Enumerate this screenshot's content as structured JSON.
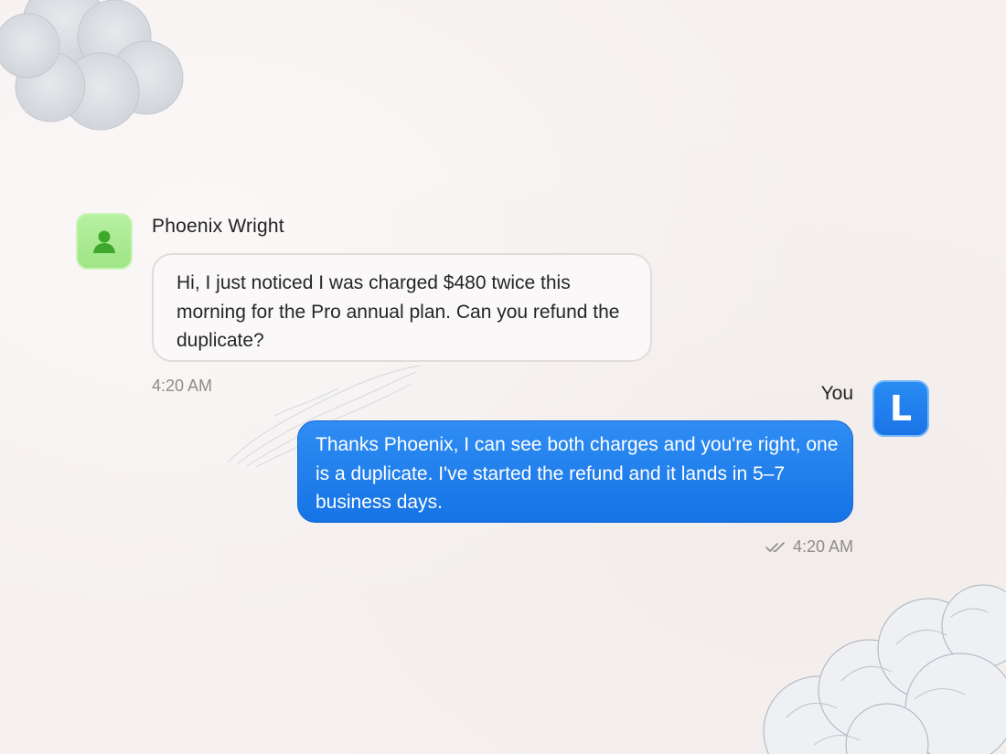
{
  "conversation": {
    "contact": {
      "name": "Phoenix Wright",
      "avatar_icon": "person-icon",
      "avatar_color": "#a8ea8c",
      "message": "Hi, I just noticed I was charged $480 twice this morning for the Pro annual plan. Can you refund the duplicate?",
      "time": "4:20 AM"
    },
    "self": {
      "name": "You",
      "avatar_initial": "L",
      "avatar_color": "#1f7fee",
      "message": "Thanks Phoenix, I can see both charges and you're right, one is a duplicate. I've started the refund and it lands in 5–7 business days.",
      "time": "4:20 AM",
      "status_icon": "double-check-icon"
    }
  },
  "theme": {
    "background": "#f6f1f0",
    "outgoing_bubble": "#1f7fee",
    "incoming_bubble": "#faf8f8",
    "timestamp_color": "#8e8b8a"
  }
}
